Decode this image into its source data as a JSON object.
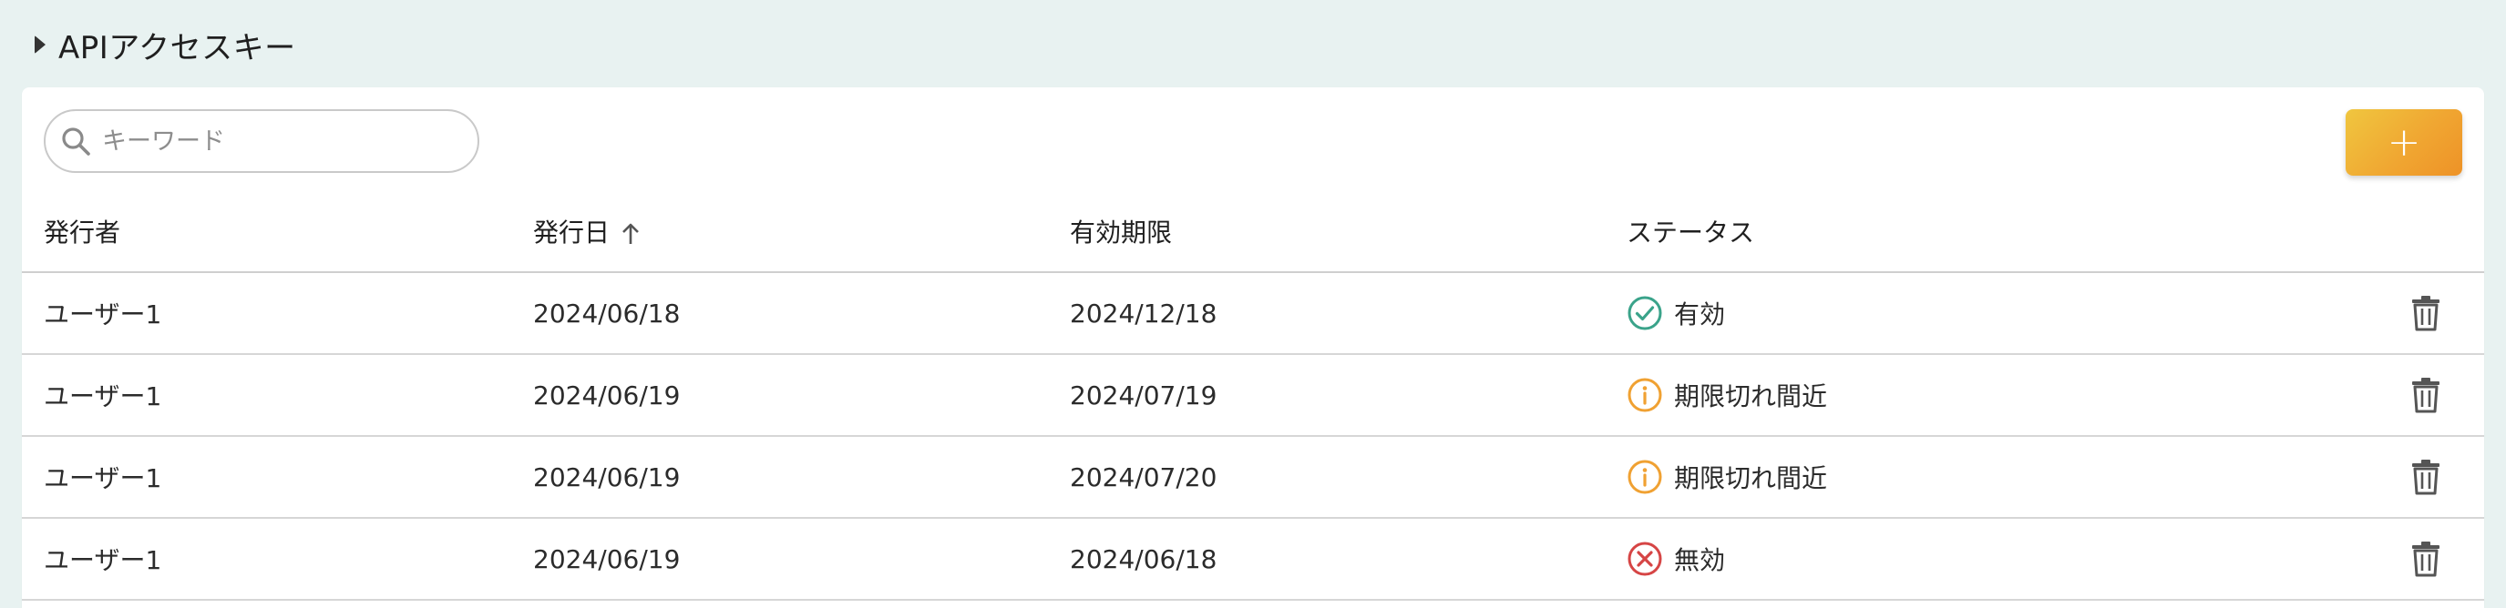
{
  "section": {
    "title": "APIアクセスキー",
    "caret_icon": "caret-right-icon"
  },
  "search": {
    "placeholder": "キーワード",
    "value": "",
    "icon": "search-icon"
  },
  "toolbar": {
    "add_label": "+",
    "add_icon": "plus-icon"
  },
  "table": {
    "headers": {
      "issuer": "発行者",
      "issued_date": "発行日",
      "expiry": "有効期限",
      "status": "ステータス"
    },
    "sort": {
      "column": "issued_date",
      "direction": "ascending",
      "icon": "arrow-up-icon"
    },
    "rows": [
      {
        "issuer": "ユーザー1",
        "issued_date": "2024/06/18",
        "expiry": "2024/12/18",
        "status": "有効",
        "status_icon": "check-circle-icon",
        "status_color": "#3aa38a"
      },
      {
        "issuer": "ユーザー1",
        "issued_date": "2024/06/19",
        "expiry": "2024/07/19",
        "status": "期限切れ間近",
        "status_icon": "info-circle-icon",
        "status_color": "#f0a132"
      },
      {
        "issuer": "ユーザー1",
        "issued_date": "2024/06/19",
        "expiry": "2024/07/20",
        "status": "期限切れ間近",
        "status_icon": "info-circle-icon",
        "status_color": "#f0a132"
      },
      {
        "issuer": "ユーザー1",
        "issued_date": "2024/06/19",
        "expiry": "2024/06/18",
        "status": "無効",
        "status_icon": "x-circle-icon",
        "status_color": "#d64545"
      }
    ],
    "row_action_icon": "trash-icon"
  },
  "colors": {
    "background": "#e8f2f1",
    "panel": "#ffffff",
    "accent": "#f0a732"
  }
}
